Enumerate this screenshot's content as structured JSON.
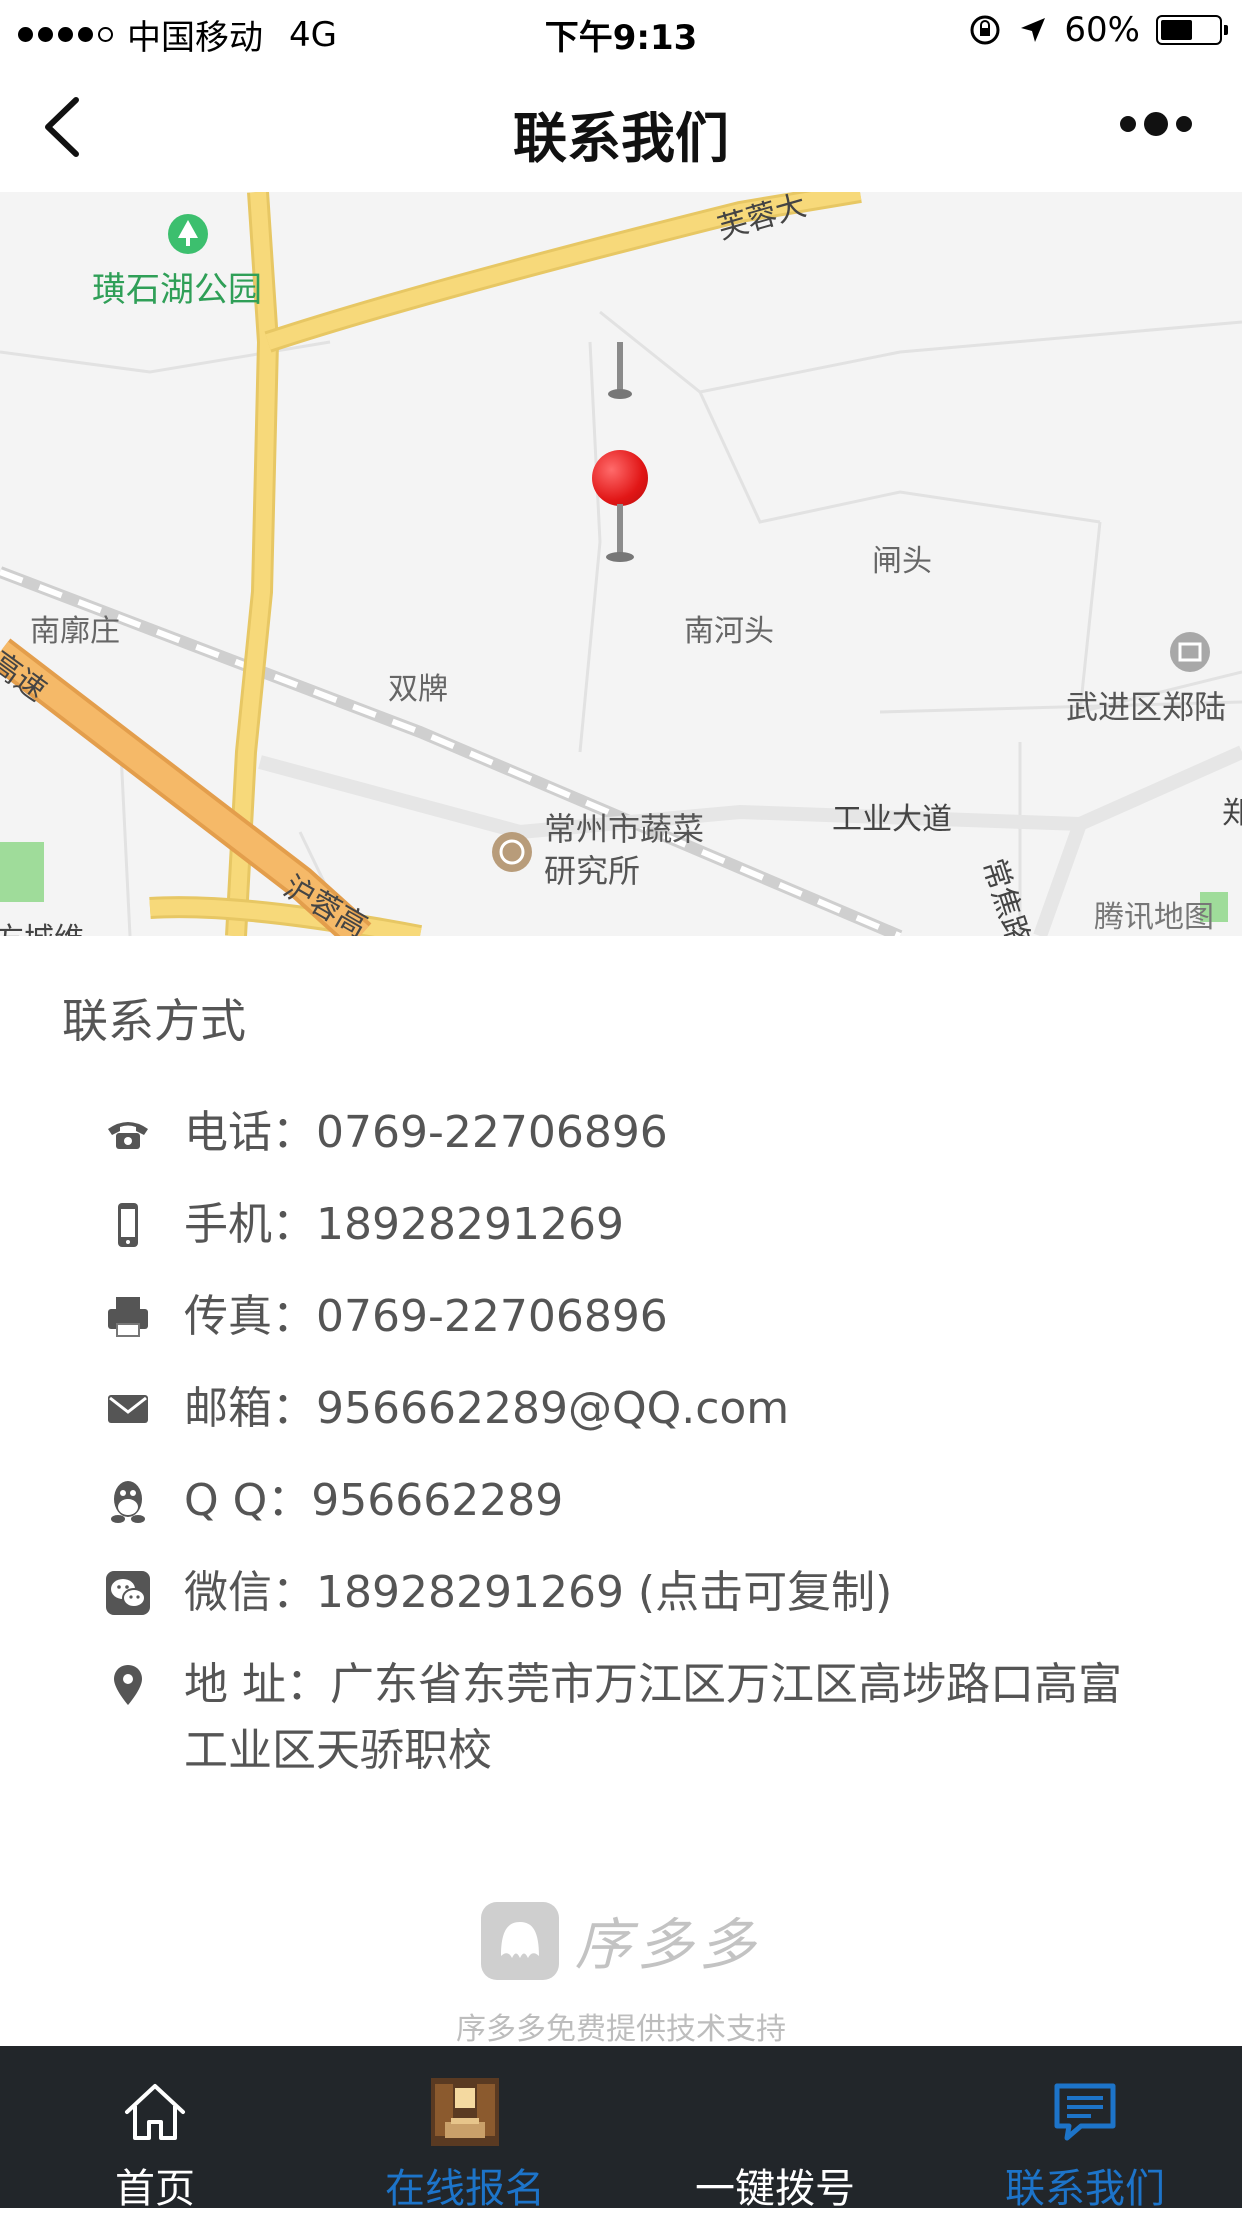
{
  "status_bar": {
    "carrier": "中国移动",
    "network": "4G",
    "time": "下午9:13",
    "battery_text": "60%",
    "battery_level": 0.6
  },
  "nav": {
    "title": "联系我们",
    "back_icon": "chevron-left-icon",
    "more_icon": "more-dots-icon"
  },
  "map": {
    "labels": {
      "park": "璜石湖公园",
      "furong": "芙蓉大",
      "zhatou": "闸头",
      "nankuozhuang": "南廓庄",
      "nanhetou": "南河头",
      "shuangpai": "双牌",
      "wujin": "武进区郑陆",
      "gaosu": "高速",
      "vegetable_institute_1": "常州市蔬菜",
      "vegetable_institute_2": "研究所",
      "gongye_road": "工业大道",
      "changjiao_road": "常焦路",
      "hurong": "沪蓉高",
      "chengwei": "方城维",
      "right_edge": "郑",
      "tencent_map": "腾讯地图"
    },
    "colors": {
      "main_road": "#f7d97a",
      "expressway": "#f5b968",
      "background": "#f4f4f4",
      "pin": "#ea1d1d"
    }
  },
  "contact": {
    "heading": "联系方式",
    "rows": [
      {
        "icon": "phone-icon",
        "text": "电话：0769-22706896"
      },
      {
        "icon": "mobile-icon",
        "text": "手机：18928291269"
      },
      {
        "icon": "fax-icon",
        "text": "传真：0769-22706896"
      },
      {
        "icon": "mail-icon",
        "text": "邮箱：956662289@QQ.com"
      },
      {
        "icon": "qq-icon",
        "text": "Q Q：956662289"
      },
      {
        "icon": "wechat-icon",
        "text": "微信：18928291269 (点击可复制)"
      },
      {
        "icon": "location-icon",
        "text": "地 址：广东省东莞市万江区万江区高埗路口高富工业区天骄职校"
      }
    ]
  },
  "brand": {
    "name": "序多多",
    "support": "序多多免费提供技术支持"
  },
  "tabs": [
    {
      "label": "首页",
      "icon": "home-icon",
      "color": "#ffffff"
    },
    {
      "label": "在线报名",
      "icon": "room-photo-icon",
      "color": "#1d74c9"
    },
    {
      "label": "一键拨号",
      "icon": "dial-icon",
      "color": "#ffffff"
    },
    {
      "label": "联系我们",
      "icon": "chat-icon",
      "color": "#1d74c9"
    }
  ]
}
